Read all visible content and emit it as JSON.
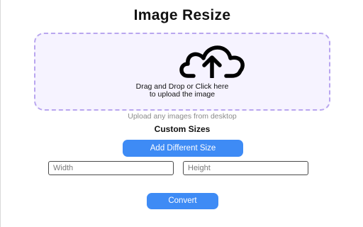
{
  "header": {
    "title": "Image Resize"
  },
  "upload": {
    "icon": "cloud-upload-icon",
    "line1": "Drag and Drop or Click here",
    "line2": "to upload the image",
    "helper": "Upload any images from desktop"
  },
  "custom_sizes": {
    "heading": "Custom Sizes",
    "add_button_label": "Add Different Size",
    "width_placeholder": "Width",
    "height_placeholder": "Height",
    "width_value": "",
    "height_value": ""
  },
  "actions": {
    "convert_label": "Convert"
  },
  "colors": {
    "accent": "#3e8bf5",
    "dropzone_border": "#b9a6ef",
    "dropzone_bg": "#f6f3ff",
    "helper_text": "#8a8a8a"
  }
}
